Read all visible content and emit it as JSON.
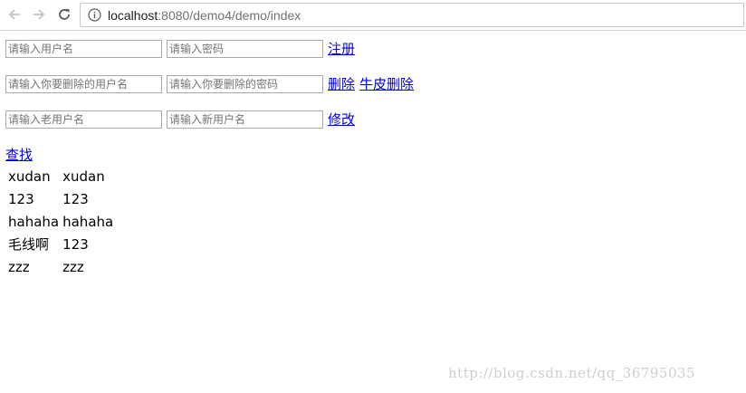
{
  "browser": {
    "url_host": "localhost",
    "url_rest": ":8080/demo4/demo/index"
  },
  "register_form": {
    "username_placeholder": "请输入用户名",
    "password_placeholder": "请输入密码",
    "register_label": "注册"
  },
  "delete_form": {
    "username_placeholder": "请输入你要删除的用户名",
    "password_placeholder": "请输入你要删除的密码",
    "delete_label": "删除",
    "fancy_delete_label": "牛皮删除"
  },
  "update_form": {
    "old_username_placeholder": "请输入老用户名",
    "new_username_placeholder": "请输入新用户名",
    "update_label": "修改"
  },
  "find_label": "查找",
  "results": {
    "rows": [
      [
        "xudan",
        "xudan"
      ],
      [
        "123",
        "123"
      ],
      [
        "hahaha",
        "hahaha"
      ],
      [
        "毛线啊",
        "123"
      ],
      [
        "zzz",
        "zzz"
      ]
    ]
  },
  "watermark": "http://blog.csdn.net/qq_36795035",
  "colors": {
    "link": "#0000ee",
    "watermark": "#cfcfcf"
  },
  "icons": [
    "back-arrow-icon",
    "forward-arrow-icon",
    "reload-icon",
    "info-icon"
  ]
}
